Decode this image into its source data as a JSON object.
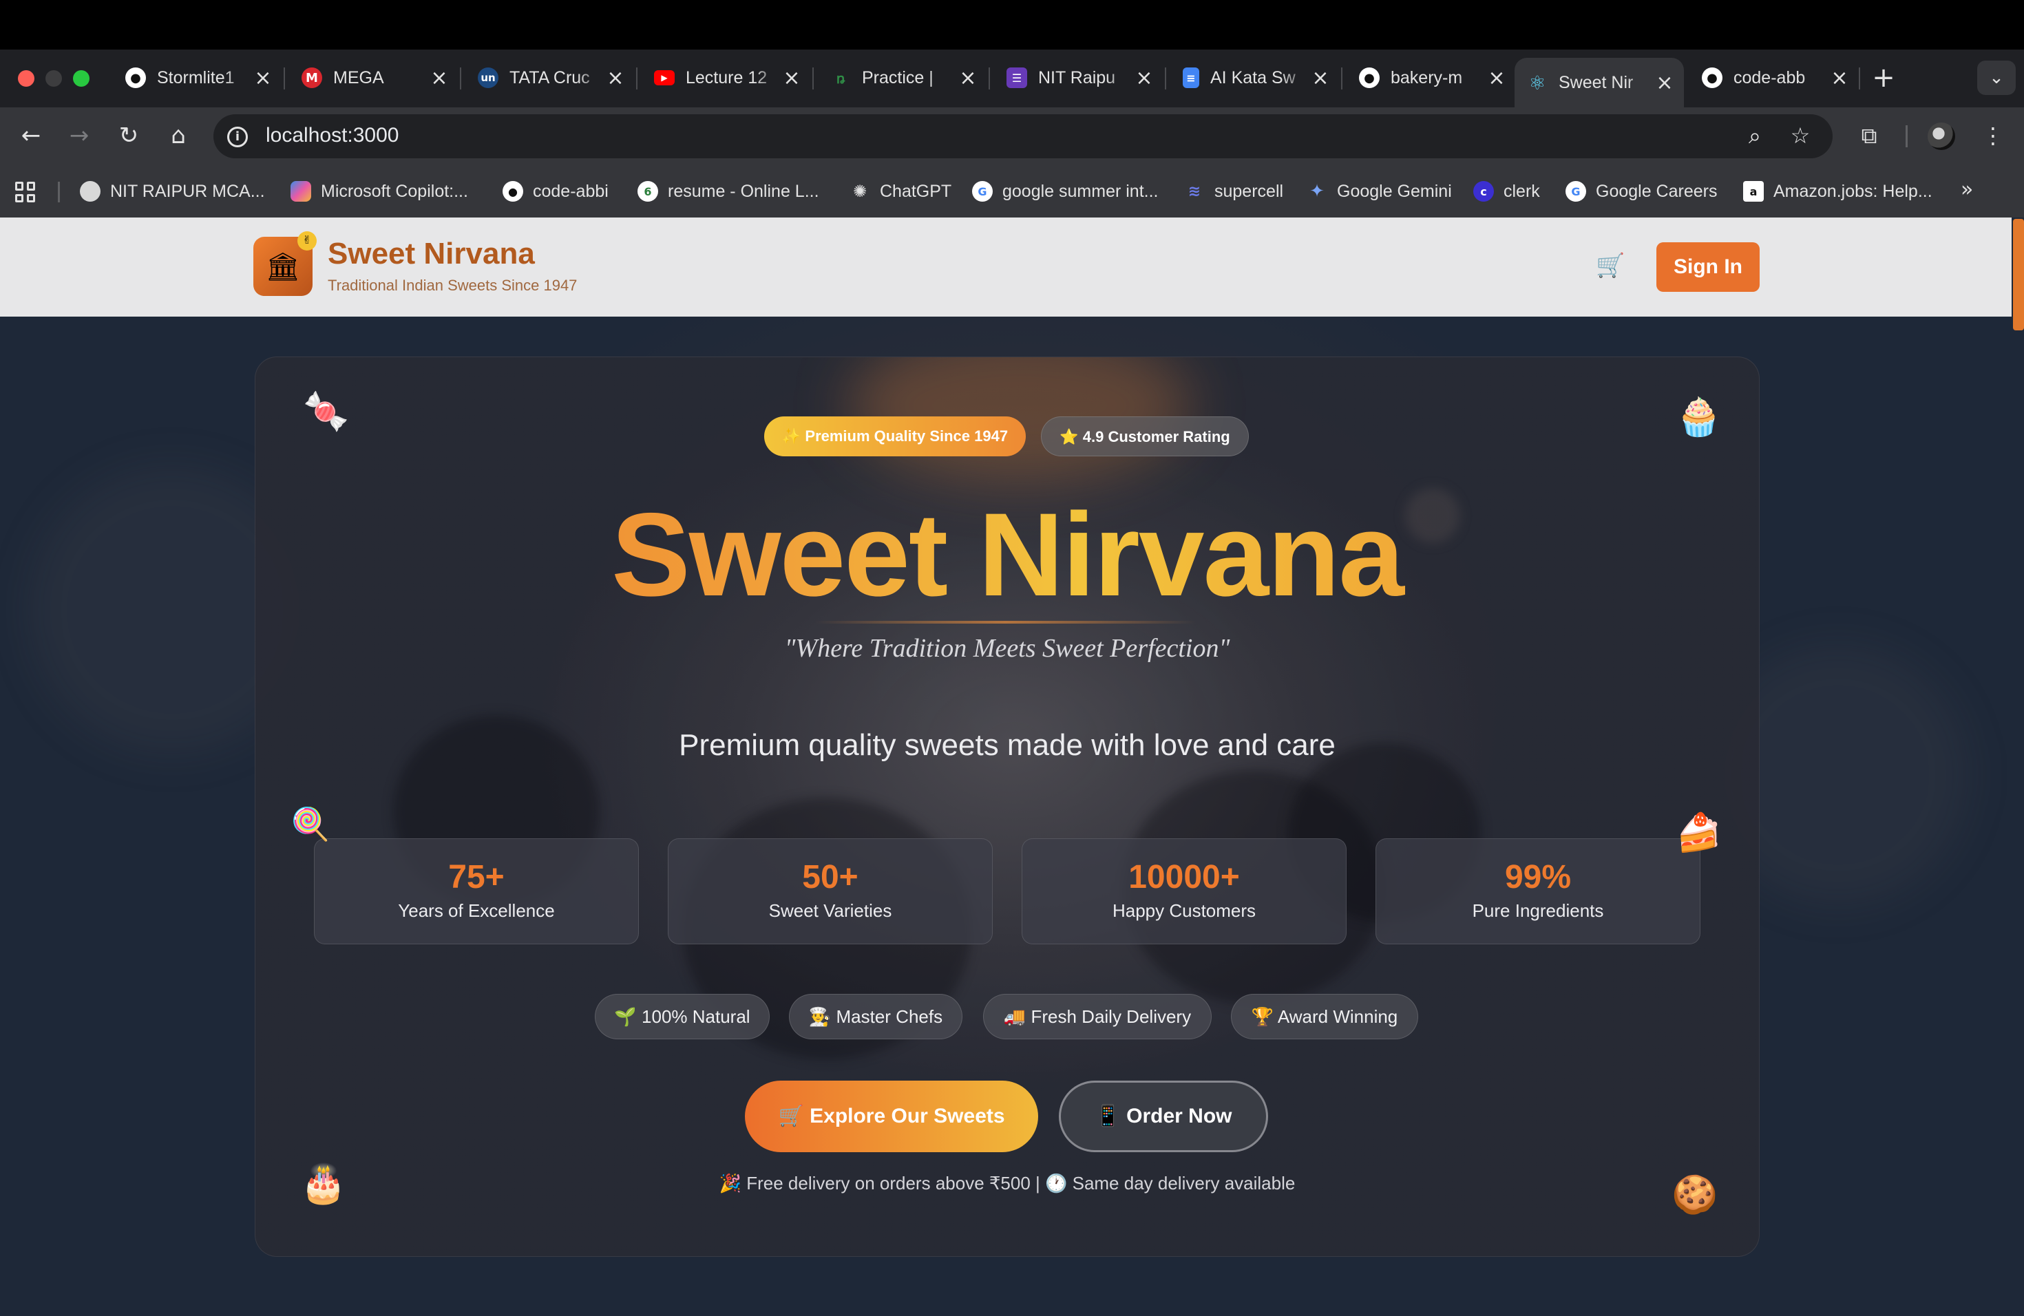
{
  "browser": {
    "tabs": [
      {
        "title": "Stormlite1",
        "icon": "github-icon",
        "color": "#ffffff"
      },
      {
        "title": "MEGA",
        "icon": "mega-icon",
        "color": "#d9272e"
      },
      {
        "title": "TATA Cruc",
        "icon": "unstop-icon",
        "color": "#1c4980"
      },
      {
        "title": "Lecture 12",
        "icon": "youtube-icon",
        "color": "#ff0000"
      },
      {
        "title": "Practice |",
        "icon": "geeksforgeeks-icon",
        "color": "#2f8d46"
      },
      {
        "title": "NIT Raipu",
        "icon": "forms-icon",
        "color": "#673ab7"
      },
      {
        "title": "AI Kata Sw",
        "icon": "docs-icon",
        "color": "#4285f4"
      },
      {
        "title": "bakery-m",
        "icon": "github-icon",
        "color": "#ffffff"
      },
      {
        "title": "Sweet Nir",
        "icon": "react-icon",
        "color": "#61dafb",
        "active": true
      },
      {
        "title": "code-abb",
        "icon": "github-icon",
        "color": "#ffffff"
      }
    ],
    "url": "localhost:3000",
    "bookmarks": [
      {
        "label": "NIT RAIPUR MCA...",
        "icon": "nit-icon"
      },
      {
        "label": "Microsoft Copilot:...",
        "icon": "copilot-icon"
      },
      {
        "label": "code-abbi",
        "icon": "github-icon"
      },
      {
        "label": "resume - Online L...",
        "icon": "overleaf-icon"
      },
      {
        "label": "ChatGPT",
        "icon": "chatgpt-icon"
      },
      {
        "label": "google summer int...",
        "icon": "google-icon"
      },
      {
        "label": "supercell",
        "icon": "supercell-icon"
      },
      {
        "label": "Google Gemini",
        "icon": "gemini-icon"
      },
      {
        "label": "clerk",
        "icon": "clerk-icon"
      },
      {
        "label": "Google Careers",
        "icon": "google-icon"
      },
      {
        "label": "Amazon.jobs: Help...",
        "icon": "amazon-icon"
      }
    ]
  },
  "site": {
    "brand": "Sweet Nirvana",
    "brand_sub": "Traditional Indian Sweets Since 1947",
    "signin": "Sign In",
    "accent": "#e8712c"
  },
  "hero": {
    "badge_primary": "✨ Premium Quality Since 1947",
    "badge_secondary": "⭐ 4.9 Customer Rating",
    "title": "Sweet Nirvana",
    "tagline": "\"Where Tradition Meets Sweet Perfection\"",
    "subtitle": "Premium quality sweets made with love and care",
    "stats": [
      {
        "value": "75+",
        "label": "Years of Excellence"
      },
      {
        "value": "50+",
        "label": "Sweet Varieties"
      },
      {
        "value": "10000+",
        "label": "Happy Customers"
      },
      {
        "value": "99%",
        "label": "Pure Ingredients"
      }
    ],
    "features": [
      "🌱 100% Natural",
      "👨‍🍳 Master Chefs",
      "🚚 Fresh Daily Delivery",
      "🏆 Award Winning"
    ],
    "explore_button": "🛒 Explore Our Sweets",
    "order_button": "📱 Order Now",
    "delivery_note": "🎉 Free delivery on orders above ₹500 | 🕐 Same day delivery available"
  }
}
